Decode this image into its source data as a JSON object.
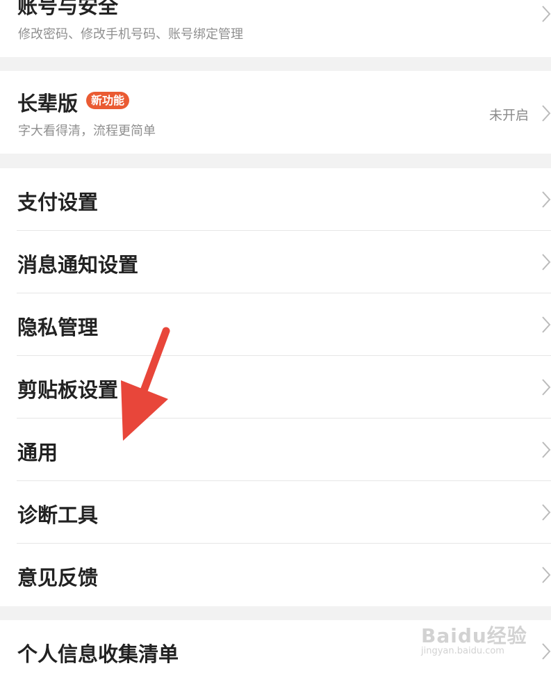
{
  "colors": {
    "background": "#f2f2f2",
    "card": "#ffffff",
    "text": "#222222",
    "subtext": "#8f8f8f",
    "badge": "#ea5b33",
    "arrow": "#e8463a"
  },
  "account_security": {
    "title": "账号与安全",
    "subtitle": "修改密码、修改手机号码、账号绑定管理"
  },
  "elder_mode": {
    "title": "长辈版",
    "badge": "新功能",
    "subtitle": "字大看得清，流程更简单",
    "status": "未开启"
  },
  "settings": {
    "items": [
      {
        "label": "支付设置"
      },
      {
        "label": "消息通知设置"
      },
      {
        "label": "隐私管理"
      },
      {
        "label": "剪贴板设置"
      },
      {
        "label": "通用"
      },
      {
        "label": "诊断工具"
      },
      {
        "label": "意见反馈"
      }
    ]
  },
  "personal_info": {
    "label": "个人信息收集清单"
  },
  "watermark": {
    "text": "Baidu经验",
    "url": "jingyan.baidu.com"
  },
  "icons": {
    "chevron": "chevron-right-icon",
    "annotation": "red-arrow-pointer"
  }
}
